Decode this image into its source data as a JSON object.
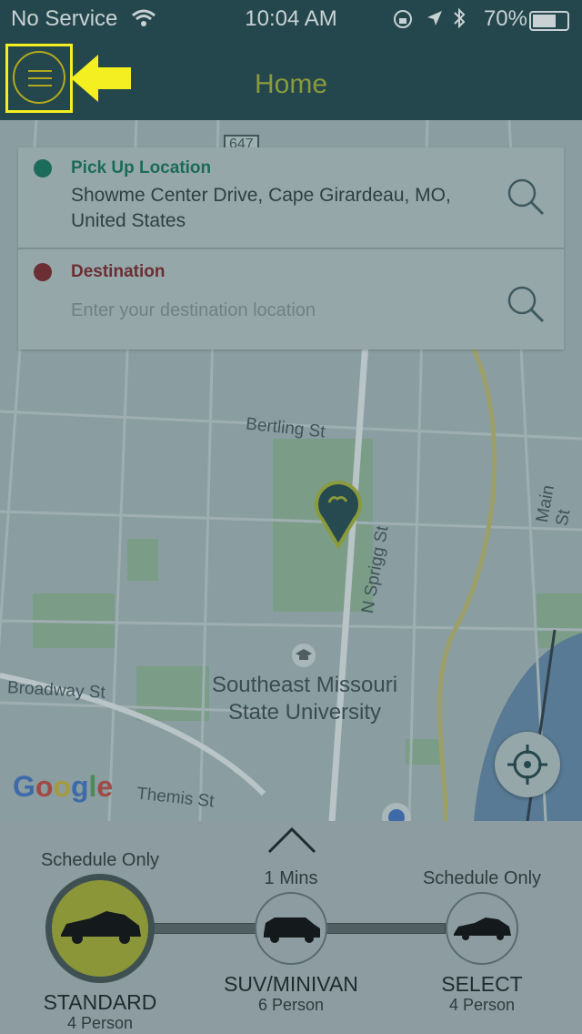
{
  "status_bar": {
    "carrier": "No Service",
    "time": "10:04 AM",
    "battery": "70%",
    "battery_level": 0.7
  },
  "header": {
    "title": "Home"
  },
  "pickup": {
    "label": "Pick Up Location",
    "value": "Showme Center Drive, Cape Girardeau, MO, United States"
  },
  "destination": {
    "label": "Destination",
    "placeholder": "Enter your destination location"
  },
  "map": {
    "labels": {
      "route": "647",
      "bertling": "Bertling St",
      "sprigg": "N Sprigg St",
      "main": "Main St",
      "broadway": "Broadway St",
      "themis": "Themis St",
      "university": "Southeast Missouri State University",
      "google": "Google"
    }
  },
  "vehicles": [
    {
      "availability": "Schedule Only",
      "name": "STANDARD",
      "capacity": "4 Person",
      "selected": true
    },
    {
      "availability": "1 Mins",
      "name": "SUV/MINIVAN",
      "capacity": "6 Person",
      "selected": false
    },
    {
      "availability": "Schedule Only",
      "name": "SELECT",
      "capacity": "4 Person",
      "selected": false
    }
  ],
  "colors": {
    "header": "#24474d",
    "accent": "#8a9a3c",
    "pickup_dot": "#1b6b5a",
    "destination_dot": "#6b2e33",
    "highlight": "#f4ef20"
  }
}
